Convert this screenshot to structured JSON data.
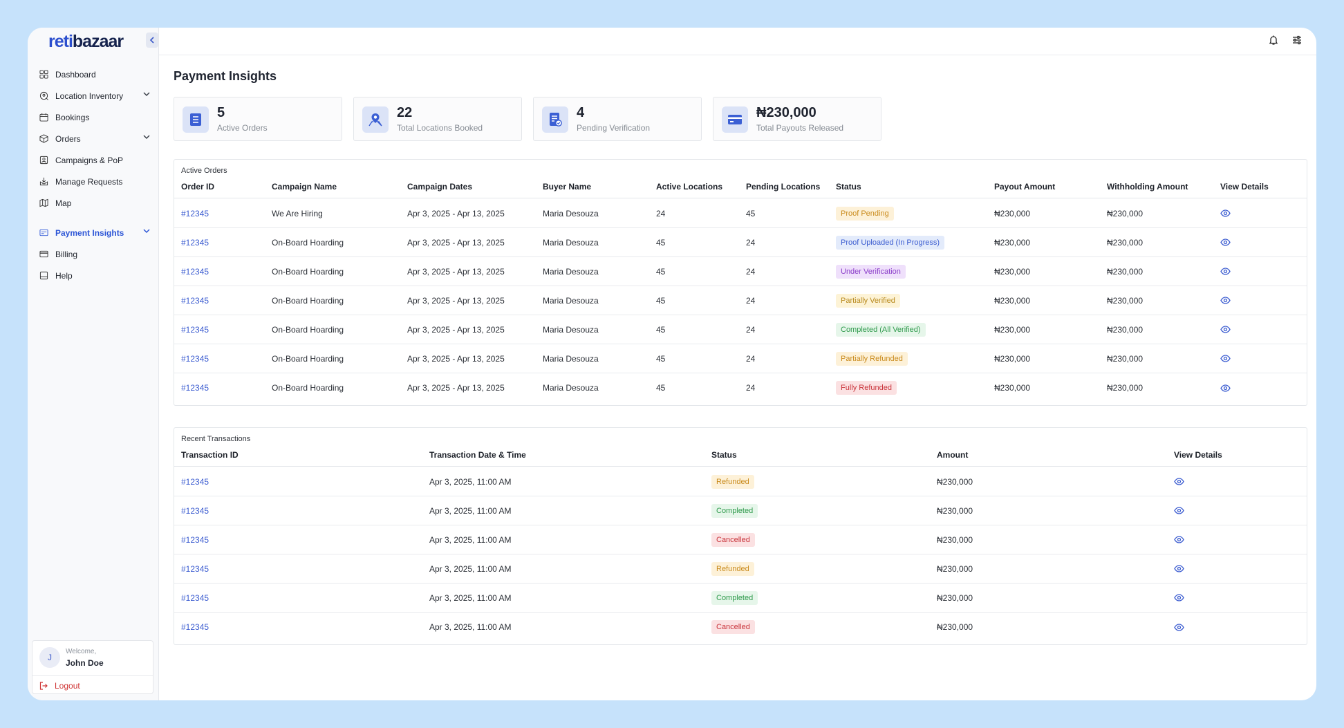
{
  "app": {
    "logo_part1": "reti",
    "logo_part2": "bazaar"
  },
  "sidebar": {
    "items": [
      {
        "label": "Dashboard",
        "icon": "grid-icon",
        "chevron": false
      },
      {
        "label": "Location Inventory",
        "icon": "location-search-icon",
        "chevron": true
      },
      {
        "label": "Bookings",
        "icon": "calendar-icon",
        "chevron": false
      },
      {
        "label": "Orders",
        "icon": "box-icon",
        "chevron": true
      },
      {
        "label": "Campaigns & PoP",
        "icon": "campaign-icon",
        "chevron": false
      },
      {
        "label": "Manage Requests",
        "icon": "inbox-icon",
        "chevron": false
      },
      {
        "label": "Map",
        "icon": "map-icon",
        "chevron": false
      },
      {
        "label": "Payment Insights",
        "icon": "payment-icon",
        "chevron": true,
        "active": true
      },
      {
        "label": "Billing",
        "icon": "card-icon",
        "chevron": false
      },
      {
        "label": "Help",
        "icon": "help-icon",
        "chevron": false
      }
    ],
    "user": {
      "initial": "J",
      "welcome": "Welcome,",
      "name": "John Doe",
      "logout": "Logout"
    }
  },
  "page": {
    "title": "Payment Insights"
  },
  "stats": [
    {
      "value": "5",
      "label": "Active Orders",
      "icon": "list-icon"
    },
    {
      "value": "22",
      "label": "Total Locations Booked",
      "icon": "location-pin-icon"
    },
    {
      "value": "4",
      "label": "Pending Verification",
      "icon": "document-check-icon"
    },
    {
      "value": "₦230,000",
      "label": "Total Payouts Released",
      "icon": "credit-card-icon"
    }
  ],
  "active_orders": {
    "caption": "Active Orders",
    "headers": [
      "Order ID",
      "Campaign Name",
      "Campaign Dates",
      "Buyer Name",
      "Active Locations",
      "Pending Locations",
      "Status",
      "Payout Amount",
      "Withholding Amount",
      "View Details"
    ],
    "rows": [
      {
        "order_id": "#12345",
        "campaign": "We Are Hiring",
        "dates": "Apr 3, 2025 - Apr 13, 2025",
        "buyer": "Maria Desouza",
        "active": "24",
        "pending": "45",
        "status": "Proof Pending",
        "payout": "₦230,000",
        "withholding": "₦230,000"
      },
      {
        "order_id": "#12345",
        "campaign": "On-Board Hoarding",
        "dates": "Apr 3, 2025 - Apr 13, 2025",
        "buyer": "Maria Desouza",
        "active": "45",
        "pending": "24",
        "status": "Proof Uploaded (In Progress)",
        "payout": "₦230,000",
        "withholding": "₦230,000"
      },
      {
        "order_id": "#12345",
        "campaign": "On-Board Hoarding",
        "dates": "Apr 3, 2025 - Apr 13, 2025",
        "buyer": "Maria Desouza",
        "active": "45",
        "pending": "24",
        "status": "Under Verification",
        "payout": "₦230,000",
        "withholding": "₦230,000"
      },
      {
        "order_id": "#12345",
        "campaign": "On-Board Hoarding",
        "dates": "Apr 3, 2025 - Apr 13, 2025",
        "buyer": "Maria Desouza",
        "active": "45",
        "pending": "24",
        "status": "Partially Verified",
        "payout": "₦230,000",
        "withholding": "₦230,000"
      },
      {
        "order_id": "#12345",
        "campaign": "On-Board Hoarding",
        "dates": "Apr 3, 2025 - Apr 13, 2025",
        "buyer": "Maria Desouza",
        "active": "45",
        "pending": "24",
        "status": "Completed (All Verified)",
        "payout": "₦230,000",
        "withholding": "₦230,000"
      },
      {
        "order_id": "#12345",
        "campaign": "On-Board Hoarding",
        "dates": "Apr 3, 2025 - Apr 13, 2025",
        "buyer": "Maria Desouza",
        "active": "45",
        "pending": "24",
        "status": "Partially Refunded",
        "payout": "₦230,000",
        "withholding": "₦230,000"
      },
      {
        "order_id": "#12345",
        "campaign": "On-Board Hoarding",
        "dates": "Apr 3, 2025 - Apr 13, 2025",
        "buyer": "Maria Desouza",
        "active": "45",
        "pending": "24",
        "status": "Fully Refunded",
        "payout": "₦230,000",
        "withholding": "₦230,000"
      }
    ]
  },
  "transactions": {
    "caption": "Recent Transactions",
    "headers": [
      "Transaction ID",
      "Transaction Date & Time",
      "Status",
      "Amount",
      "View Details"
    ],
    "rows": [
      {
        "id": "#12345",
        "datetime": "Apr 3, 2025, 11:00 AM",
        "status": "Refunded",
        "amount": "₦230,000"
      },
      {
        "id": "#12345",
        "datetime": "Apr 3, 2025, 11:00 AM",
        "status": "Completed",
        "amount": "₦230,000"
      },
      {
        "id": "#12345",
        "datetime": "Apr 3, 2025, 11:00 AM",
        "status": "Cancelled",
        "amount": "₦230,000"
      },
      {
        "id": "#12345",
        "datetime": "Apr 3, 2025, 11:00 AM",
        "status": "Refunded",
        "amount": "₦230,000"
      },
      {
        "id": "#12345",
        "datetime": "Apr 3, 2025, 11:00 AM",
        "status": "Completed",
        "amount": "₦230,000"
      },
      {
        "id": "#12345",
        "datetime": "Apr 3, 2025, 11:00 AM",
        "status": "Cancelled",
        "amount": "₦230,000"
      }
    ]
  },
  "status_colors": {
    "Proof Pending": {
      "bg": "#fdf1d8",
      "fg": "#c98a1b"
    },
    "Proof Uploaded (In Progress)": {
      "bg": "#e3ebfb",
      "fg": "#3a5bd0"
    },
    "Under Verification": {
      "bg": "#efe0fb",
      "fg": "#8a3bc9"
    },
    "Partially Verified": {
      "bg": "#fdf3d6",
      "fg": "#b8891c"
    },
    "Completed (All Verified)": {
      "bg": "#e6f6ea",
      "fg": "#2f9a4c"
    },
    "Partially Refunded": {
      "bg": "#fdf1d8",
      "fg": "#c98a1b"
    },
    "Fully Refunded": {
      "bg": "#fbe1e2",
      "fg": "#c9343b"
    },
    "Refunded": {
      "bg": "#fdf1d8",
      "fg": "#c98a1b"
    },
    "Completed": {
      "bg": "#e6f6ea",
      "fg": "#2f9a4c"
    },
    "Cancelled": {
      "bg": "#fbe1e2",
      "fg": "#c9343b"
    }
  },
  "theme": {
    "accent": "#2c55d6",
    "page_bg": "#c6e2fb"
  }
}
